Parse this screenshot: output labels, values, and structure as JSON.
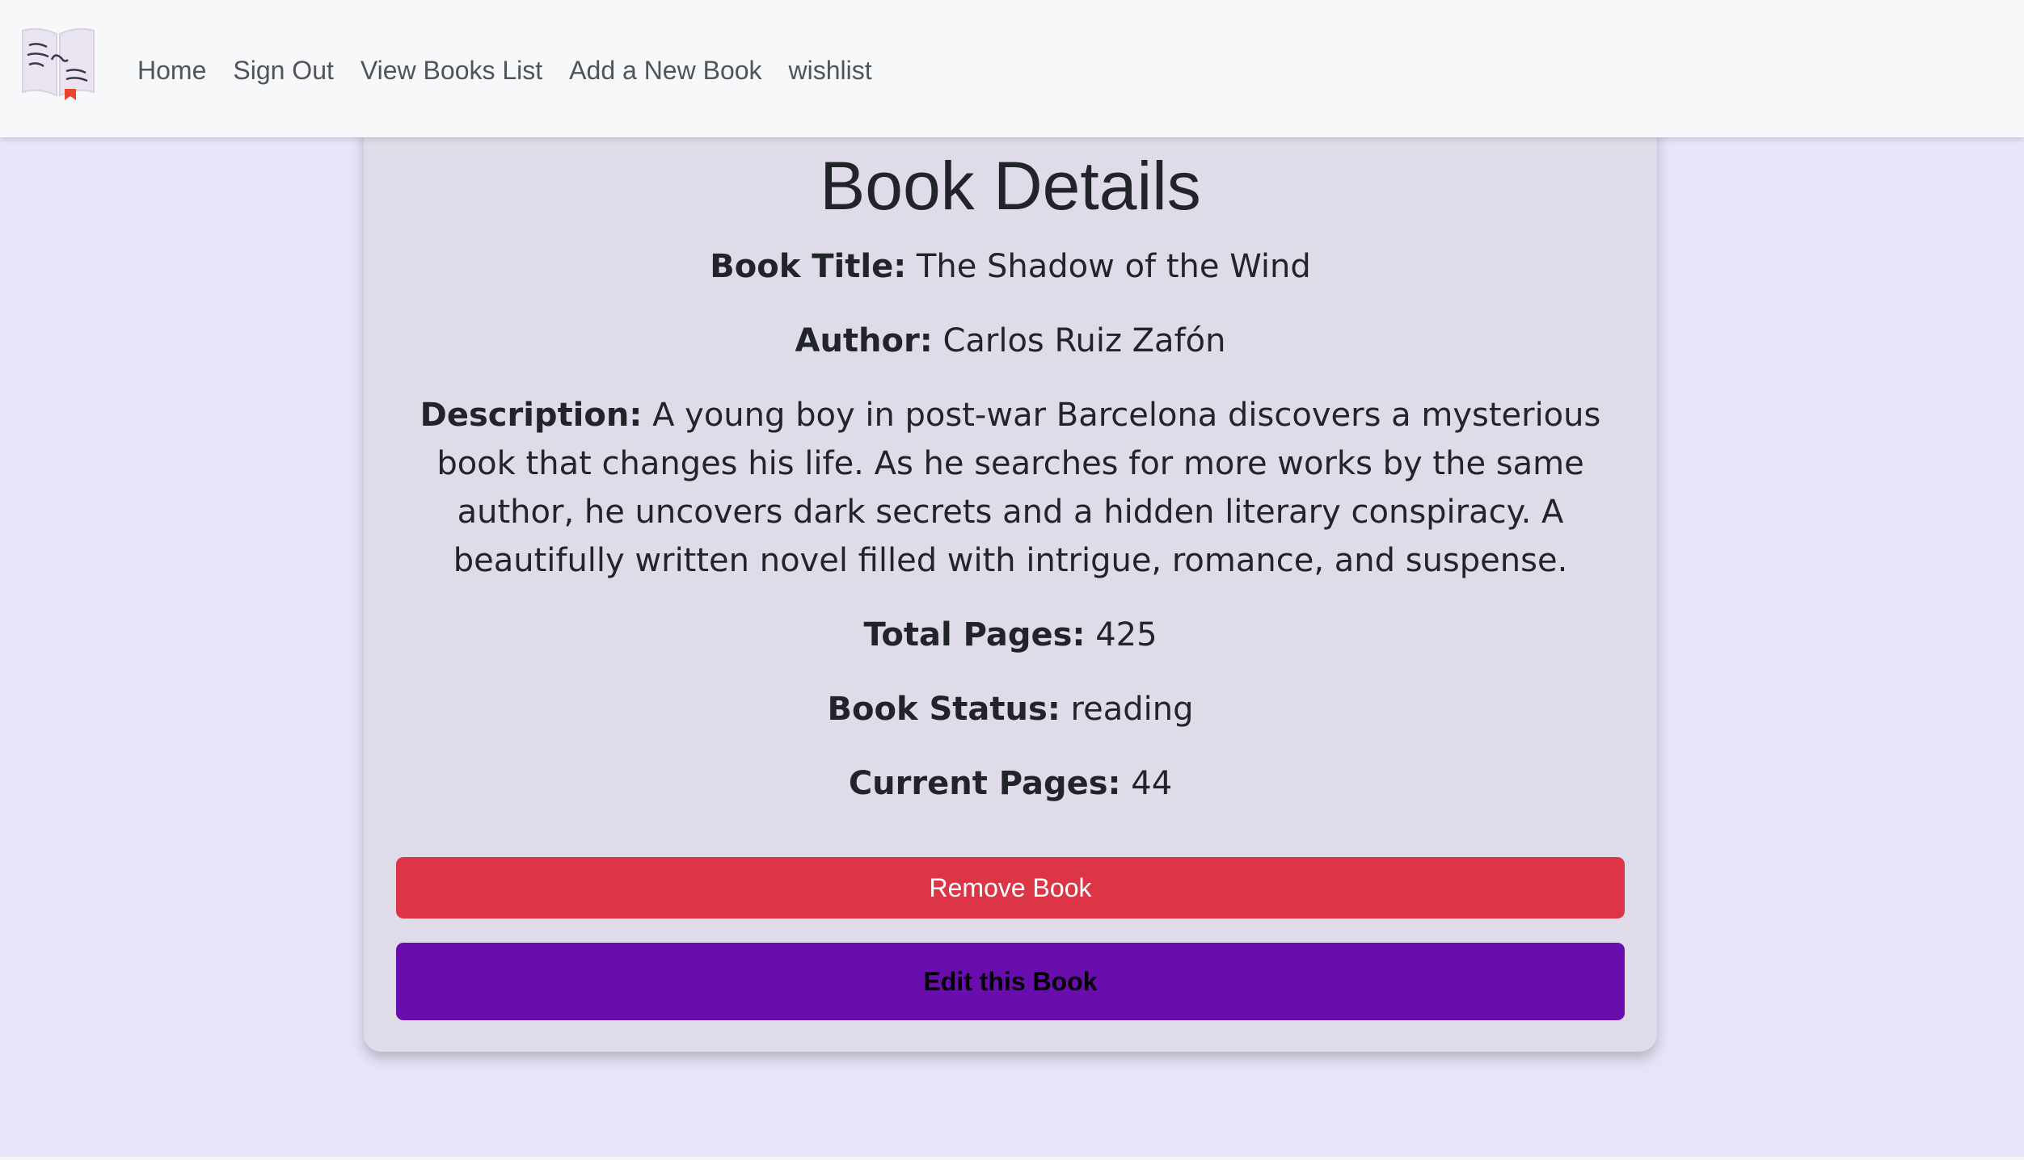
{
  "nav": {
    "items": [
      {
        "label": "Home"
      },
      {
        "label": "Sign Out"
      },
      {
        "label": "View Books List"
      },
      {
        "label": "Add a New Book"
      },
      {
        "label": "wishlist"
      }
    ]
  },
  "book": {
    "heading": "Book Details",
    "title_label": "Book Title:",
    "title_value": "The Shadow of the Wind",
    "author_label": "Author:",
    "author_value": "Carlos Ruiz Zafón",
    "description_label": "Description:",
    "description_value": "A young boy in post-war Barcelona discovers a mysterious book that changes his life. As he searches for more works by the same author, he uncovers dark secrets and a hidden literary conspiracy. A beautifully written novel filled with intrigue, romance, and suspense.",
    "pages_label": "Total Pages:",
    "pages_value": "425",
    "status_label": "Book Status:",
    "status_value": "reading",
    "current_label": "Current Pages:",
    "current_value": "44"
  },
  "actions": {
    "remove_label": "Remove Book",
    "edit_label": "Edit this Book"
  },
  "colors": {
    "page_bg": "#e6e4f8",
    "card_bg": "#e0dbe8",
    "remove": "#dc3545",
    "edit": "#6a0dad"
  },
  "icons": {
    "logo": "open-book-icon"
  }
}
